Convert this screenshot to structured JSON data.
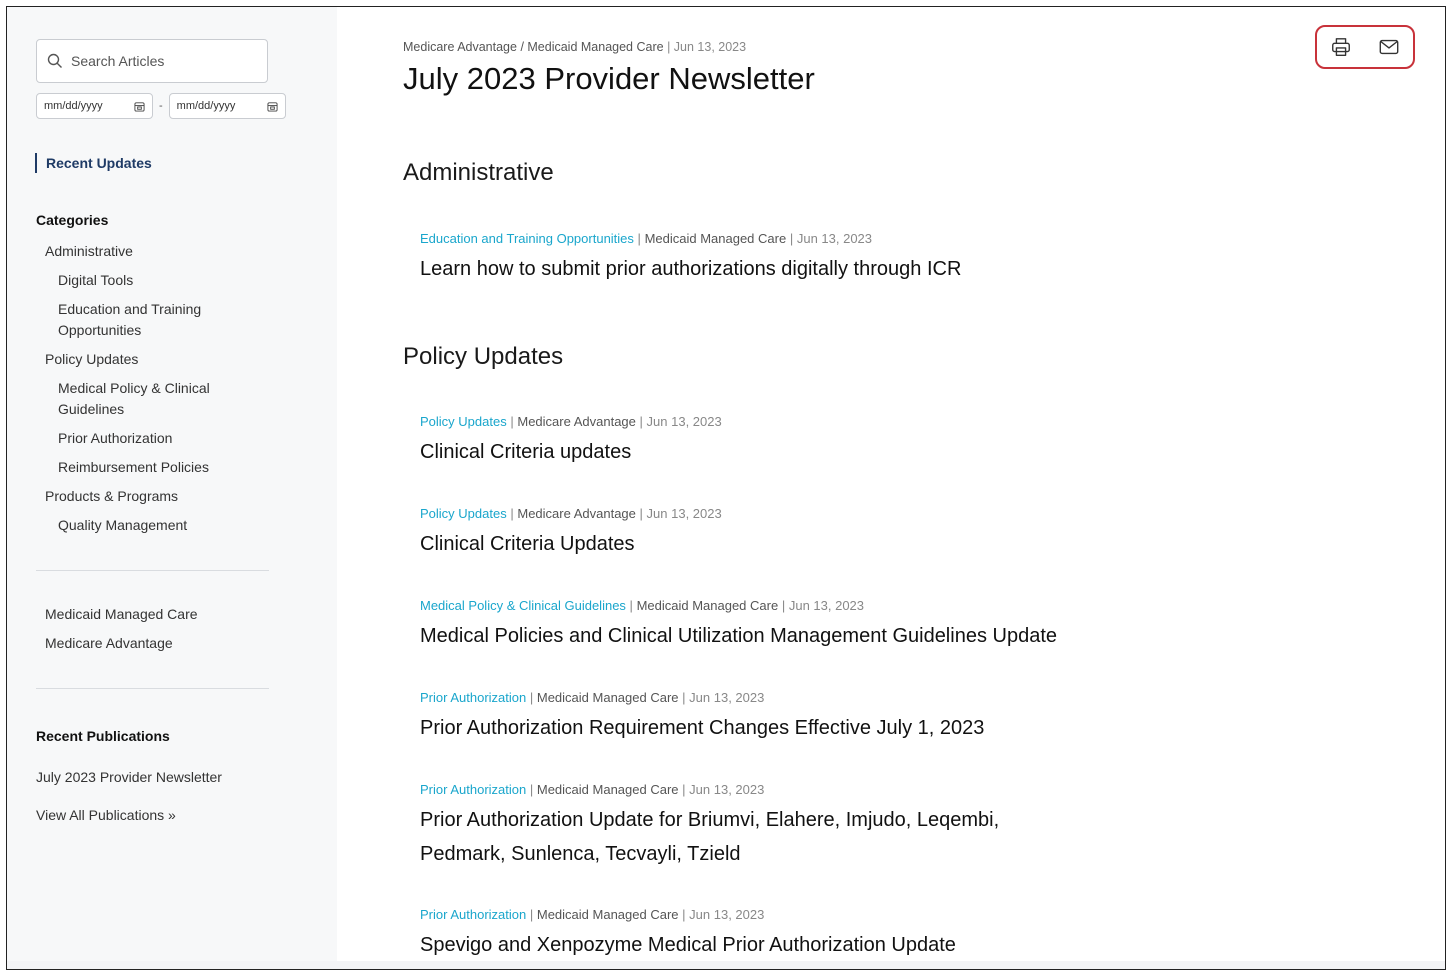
{
  "search": {
    "placeholder": "Search Articles"
  },
  "date_filter": {
    "from": "mm/dd/yyyy",
    "separator": "-",
    "to": "mm/dd/yyyy"
  },
  "sidebar": {
    "recent_updates": "Recent Updates",
    "categories_heading": "Categories",
    "categories": [
      {
        "label": "Administrative",
        "level": 1
      },
      {
        "label": "Digital Tools",
        "level": 2
      },
      {
        "label": "Education and Training Opportunities",
        "level": 2
      },
      {
        "label": "Policy Updates",
        "level": 1
      },
      {
        "label": "Medical Policy & Clinical Guidelines",
        "level": 2
      },
      {
        "label": "Prior Authorization",
        "level": 2
      },
      {
        "label": "Reimbursement Policies",
        "level": 2
      },
      {
        "label": "Products & Programs",
        "level": 1
      },
      {
        "label": "Quality Management",
        "level": 2
      }
    ],
    "lines_of_business": [
      "Medicaid Managed Care",
      "Medicare Advantage"
    ],
    "publications_heading": "Recent Publications",
    "publications": [
      "July 2023 Provider Newsletter",
      "View All Publications »"
    ]
  },
  "header": {
    "breadcrumb": "Medicare Advantage / Medicaid Managed Care",
    "separator": "|",
    "date": "Jun 13, 2023",
    "title": "July 2023 Provider Newsletter",
    "actions": [
      {
        "icon": "printer-icon"
      },
      {
        "icon": "mail-icon"
      }
    ]
  },
  "sections": [
    {
      "title": "Administrative",
      "articles": [
        {
          "category": "Education and Training Opportunities",
          "line": "Medicaid Managed Care",
          "date": "Jun 13, 2023",
          "title": "Learn how to submit prior authorizations digitally through ICR"
        }
      ]
    },
    {
      "title": "Policy Updates",
      "articles": [
        {
          "category": "Policy Updates",
          "line": "Medicare Advantage",
          "date": "Jun 13, 2023",
          "title": "Clinical Criteria updates"
        },
        {
          "category": "Policy Updates",
          "line": "Medicare Advantage",
          "date": "Jun 13, 2023",
          "title": "Clinical Criteria Updates"
        },
        {
          "category": "Medical Policy & Clinical Guidelines",
          "line": "Medicaid Managed Care",
          "date": "Jun 13, 2023",
          "title": "Medical Policies and Clinical Utilization Management Guidelines Update"
        },
        {
          "category": "Prior Authorization",
          "line": "Medicaid Managed Care",
          "date": "Jun 13, 2023",
          "title": "Prior Authorization Requirement Changes Effective July 1, 2023"
        },
        {
          "category": "Prior Authorization",
          "line": "Medicaid Managed Care",
          "date": "Jun 13, 2023",
          "title": "Prior Authorization Update for Briumvi, Elahere, Imjudo, Leqembi, Pedmark, Sunlenca, Tecvayli, Tzield"
        },
        {
          "category": "Prior Authorization",
          "line": "Medicaid Managed Care",
          "date": "Jun 13, 2023",
          "title": "Spevigo and Xenpozyme Medical Prior Authorization Update"
        }
      ]
    }
  ],
  "colors": {
    "accent_link": "#1aa6cc",
    "nav_active": "#1f3b66",
    "highlight_box": "#c8323a"
  }
}
